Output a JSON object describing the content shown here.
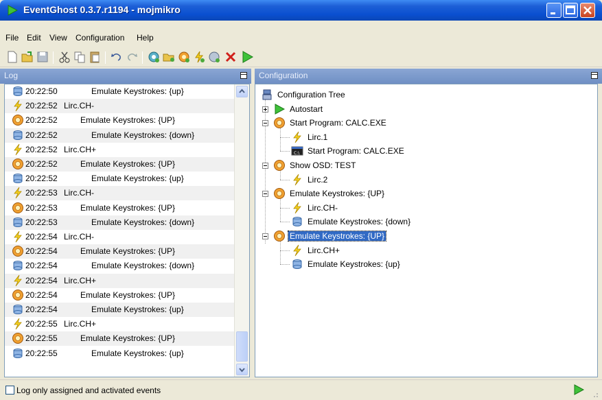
{
  "window": {
    "title": "EventGhost 0.3.7.r1194 - mojmikro",
    "colors": {
      "titlebar": "#0a4fd0",
      "selection": "#316ac5",
      "pane_header": "#7f98c8"
    }
  },
  "menu": {
    "file": "File",
    "edit": "Edit",
    "view": "View",
    "configuration": "Configuration",
    "help": "Help"
  },
  "toolbar": {
    "icons": [
      "new-file-icon",
      "open-folder-icon",
      "save-icon",
      "cut-icon",
      "copy-icon",
      "paste-icon",
      "undo-icon",
      "redo-icon",
      "add-plugin-icon",
      "add-folder-icon",
      "add-macro-icon",
      "add-event-icon",
      "add-action-icon",
      "delete-icon",
      "execute-icon"
    ]
  },
  "log_panel": {
    "title": "Log",
    "rows": [
      {
        "icon": "action",
        "time": "20:22:50",
        "message": "Emulate Keystrokes: {up}"
      },
      {
        "icon": "event",
        "time": "20:22:52",
        "message": "Lirc.CH-"
      },
      {
        "icon": "macro",
        "time": "20:22:52",
        "message": "Emulate Keystrokes: {UP}"
      },
      {
        "icon": "action",
        "time": "20:22:52",
        "message": "Emulate Keystrokes: {down}"
      },
      {
        "icon": "event",
        "time": "20:22:52",
        "message": "Lirc.CH+"
      },
      {
        "icon": "macro",
        "time": "20:22:52",
        "message": "Emulate Keystrokes: {UP}"
      },
      {
        "icon": "action",
        "time": "20:22:52",
        "message": "Emulate Keystrokes: {up}"
      },
      {
        "icon": "event",
        "time": "20:22:53",
        "message": "Lirc.CH-"
      },
      {
        "icon": "macro",
        "time": "20:22:53",
        "message": "Emulate Keystrokes: {UP}"
      },
      {
        "icon": "action",
        "time": "20:22:53",
        "message": "Emulate Keystrokes: {down}"
      },
      {
        "icon": "event",
        "time": "20:22:54",
        "message": "Lirc.CH-"
      },
      {
        "icon": "macro",
        "time": "20:22:54",
        "message": "Emulate Keystrokes: {UP}"
      },
      {
        "icon": "action",
        "time": "20:22:54",
        "message": "Emulate Keystrokes: {down}"
      },
      {
        "icon": "event",
        "time": "20:22:54",
        "message": "Lirc.CH+"
      },
      {
        "icon": "macro",
        "time": "20:22:54",
        "message": "Emulate Keystrokes: {UP}"
      },
      {
        "icon": "action",
        "time": "20:22:54",
        "message": "Emulate Keystrokes: {up}"
      },
      {
        "icon": "event",
        "time": "20:22:55",
        "message": "Lirc.CH+"
      },
      {
        "icon": "macro",
        "time": "20:22:55",
        "message": "Emulate Keystrokes: {UP}"
      },
      {
        "icon": "action",
        "time": "20:22:55",
        "message": "Emulate Keystrokes: {up}"
      }
    ]
  },
  "config_panel": {
    "title": "Configuration",
    "tree": [
      {
        "label": "Configuration Tree",
        "icon": "config-tree",
        "level": 0
      },
      {
        "label": "Autostart",
        "icon": "autostart",
        "level": 1,
        "expander": "plus"
      },
      {
        "label": "Start Program: CALC.EXE",
        "icon": "macro",
        "level": 1,
        "expander": "minus"
      },
      {
        "label": "Lirc.1",
        "icon": "event",
        "level": 2
      },
      {
        "label": "Start Program: CALC.EXE",
        "icon": "program",
        "level": 2
      },
      {
        "label": "Show OSD: TEST",
        "icon": "macro",
        "level": 1,
        "expander": "minus"
      },
      {
        "label": "Lirc.2",
        "icon": "event",
        "level": 2
      },
      {
        "label": "Emulate Keystrokes: {UP}",
        "icon": "macro",
        "level": 1,
        "expander": "minus"
      },
      {
        "label": "Lirc.CH-",
        "icon": "event",
        "level": 2
      },
      {
        "label": "Emulate Keystrokes: {down}",
        "icon": "action",
        "level": 2
      },
      {
        "label": "Emulate Keystrokes: {UP}",
        "icon": "macro",
        "level": 1,
        "expander": "minus",
        "selected": true
      },
      {
        "label": "Lirc.CH+",
        "icon": "event",
        "level": 2
      },
      {
        "label": "Emulate Keystrokes: {up}",
        "icon": "action",
        "level": 2
      }
    ]
  },
  "statusbar": {
    "checkbox_label": "Log only assigned and activated events",
    "checkbox_checked": false
  }
}
